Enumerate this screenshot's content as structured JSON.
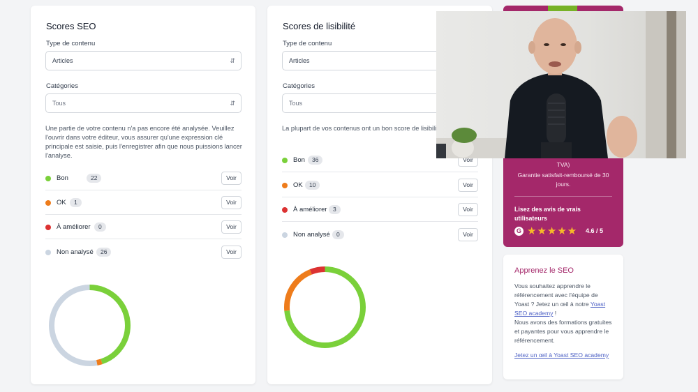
{
  "seo": {
    "title": "Scores SEO",
    "content_type_label": "Type de contenu",
    "content_type_value": "Articles",
    "categories_label": "Catégories",
    "categories_value": "Tous",
    "description": "Une partie de votre contenu n'a pas encore été analysée. Veuillez l'ouvrir dans votre éditeur, vous assurer qu'une expression clé principale est saisie, puis l'enregistrer afin que nous puissions lancer l'analyse.",
    "rows": [
      {
        "label": "Bon",
        "count": "22",
        "color": "#7ad03a",
        "action": "Voir"
      },
      {
        "label": "OK",
        "count": "1",
        "color": "#ee7c1b",
        "action": "Voir"
      },
      {
        "label": "À améliorer",
        "count": "0",
        "color": "#dc3232",
        "action": "Voir"
      },
      {
        "label": "Non analysé",
        "count": "26",
        "color": "#cbd5e1",
        "action": "Voir"
      }
    ],
    "donut": [
      {
        "label": "Bon",
        "value": 22,
        "color": "#7ad03a"
      },
      {
        "label": "OK",
        "value": 1,
        "color": "#ee7c1b"
      },
      {
        "label": "À améliorer",
        "value": 0,
        "color": "#dc3232"
      },
      {
        "label": "Non analysé",
        "value": 26,
        "color": "#cbd5e1"
      }
    ]
  },
  "readability": {
    "title": "Scores de lisibilité",
    "content_type_label": "Type de contenu",
    "content_type_value": "Articles",
    "categories_label": "Catégories",
    "categories_value": "Tous",
    "description": "La plupart de vos contenus ont un bon score de lisibilité. Très bien !",
    "rows": [
      {
        "label": "Bon",
        "count": "36",
        "color": "#7ad03a",
        "action": "Voir"
      },
      {
        "label": "OK",
        "count": "10",
        "color": "#ee7c1b",
        "action": "Voir"
      },
      {
        "label": "À améliorer",
        "count": "3",
        "color": "#dc3232",
        "action": "Voir"
      },
      {
        "label": "Non analysé",
        "count": "0",
        "color": "#cbd5e1",
        "action": "Voir"
      }
    ],
    "donut": [
      {
        "label": "Bon",
        "value": 36,
        "color": "#7ad03a"
      },
      {
        "label": "OK",
        "value": 10,
        "color": "#ee7c1b"
      },
      {
        "label": "À améliorer",
        "value": 3,
        "color": "#dc3232"
      },
      {
        "label": "Non analysé",
        "value": 0,
        "color": "#cbd5e1"
      }
    ]
  },
  "promo": {
    "vat_fragment": "TVA)",
    "guarantee": "Garantie satisfait-remboursé de 30 jours.",
    "reviews_title": "Lisez des avis de vrais utilisateurs",
    "review_icon": "G",
    "stars": "★★★★★",
    "rating": "4.6 / 5",
    "bg_color": "#a4286a"
  },
  "learn": {
    "title": "Apprenez le SEO",
    "body_before_link": "Vous souhaitez apprendre le référencement avec l'équipe de Yoast ? Jetez un œil à notre ",
    "academy_link": "Yoast SEO academy",
    "body_after_link": " !",
    "body_2": "Nous avons des formations gratuites et payantes pour vous apprendre le référencement.",
    "cta": "Jetez un œil à Yoast SEO academy"
  },
  "video": {
    "description": "Presenter speaking into a microphone"
  }
}
